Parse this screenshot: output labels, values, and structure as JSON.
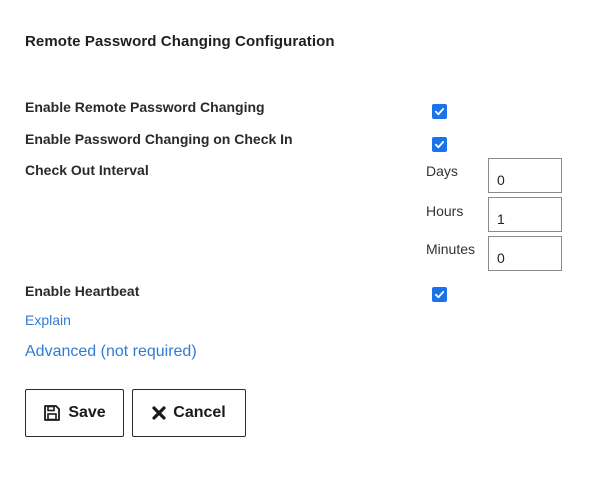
{
  "page": {
    "title": "Remote Password Changing Configuration"
  },
  "settings": {
    "enable_rpc": {
      "label": "Enable Remote Password Changing",
      "checked": true
    },
    "enable_checkin": {
      "label": "Enable Password Changing on Check In",
      "checked": true
    },
    "checkout_interval": {
      "label": "Check Out Interval",
      "days_label": "Days",
      "days_value": "0",
      "hours_label": "Hours",
      "hours_value": "1",
      "minutes_label": "Minutes",
      "minutes_value": "0"
    },
    "enable_heartbeat": {
      "label": "Enable Heartbeat",
      "checked": true
    }
  },
  "links": {
    "explain": "Explain",
    "advanced": "Advanced (not required)"
  },
  "buttons": {
    "save": "Save",
    "cancel": "Cancel"
  },
  "colors": {
    "accent": "#1a73e8",
    "link": "#2f7bd6"
  },
  "icons": {
    "checkbox": "check-icon",
    "save": "floppy-disk-icon",
    "cancel": "x-icon"
  }
}
